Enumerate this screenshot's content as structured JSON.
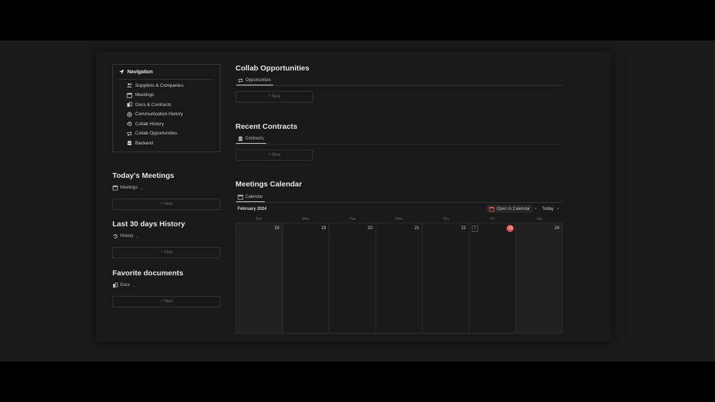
{
  "navigation": {
    "title": "Navigation",
    "items": [
      {
        "label": "Suppliers & Companies",
        "icon": "people-icon"
      },
      {
        "label": "Meetings",
        "icon": "calendar-icon"
      },
      {
        "label": "Docs & Contracts",
        "icon": "documents-icon"
      },
      {
        "label": "Communication History",
        "icon": "at-icon"
      },
      {
        "label": "Collab History",
        "icon": "history-icon"
      },
      {
        "label": "Collab Opportunities",
        "icon": "repeat-icon"
      },
      {
        "label": "Backend",
        "icon": "database-icon"
      }
    ]
  },
  "today_meetings": {
    "title": "Today's Meetings",
    "view": "Meetings",
    "new_label": "+ New"
  },
  "last_30": {
    "title": "Last 30 days History",
    "view": "History",
    "new_label": "+ New"
  },
  "favorites": {
    "title": "Favorite documents",
    "view": "Docs",
    "new_label": "+ New"
  },
  "collab": {
    "title": "Collab Opportunities",
    "tab": "Opportunities",
    "new_label": "+ New"
  },
  "contracts": {
    "title": "Recent Contracts",
    "tab": "Contracts",
    "new_label": "+ New"
  },
  "calendar": {
    "title": "Meetings Calendar",
    "tab": "Calendar",
    "month": "February 2024",
    "open_label": "Open in Calendar",
    "today_label": "Today",
    "weekdays": [
      "Sun",
      "Mon",
      "Tue",
      "Wed",
      "Thu",
      "Fri",
      "Sat"
    ],
    "days": [
      "18",
      "19",
      "20",
      "21",
      "22",
      "23",
      "24"
    ],
    "today_index": 5,
    "today_color": "#e05555"
  }
}
